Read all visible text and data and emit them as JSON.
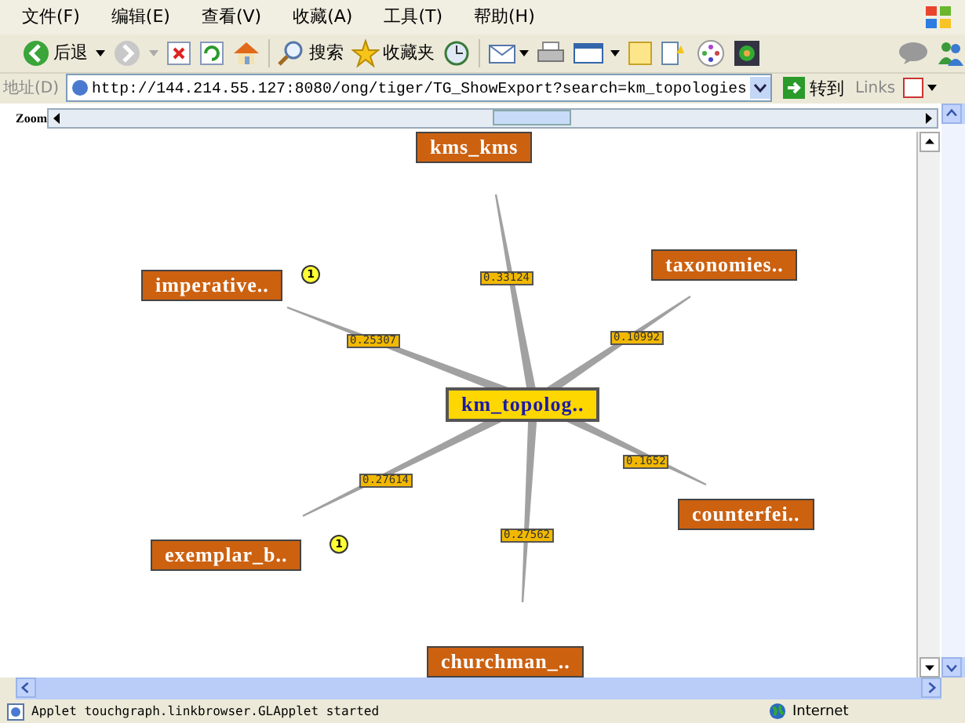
{
  "menu": [
    "文件(F)",
    "编辑(E)",
    "查看(V)",
    "收藏(A)",
    "工具(T)",
    "帮助(H)"
  ],
  "toolbar": {
    "back": "后退",
    "search": "搜索",
    "favorites": "收藏夹"
  },
  "address": {
    "label": "地址(D)",
    "url": "http://144.214.55.127:8080/ong/tiger/TG_ShowExport?search=km_topologies",
    "go": "转到",
    "links": "Links"
  },
  "applet": {
    "zoom": {
      "label": "Zoom",
      "level": 0.5
    },
    "center": {
      "label": "km_topolog.."
    },
    "nodes": [
      {
        "label": "kms_kms",
        "edge_label": "0.33124"
      },
      {
        "label": "imperative..",
        "edge_label": "0.25307",
        "badge": "1"
      },
      {
        "label": "taxonomies..",
        "edge_label": "0.10992"
      },
      {
        "label": "counterfei..",
        "edge_label": "0.1652"
      },
      {
        "label": "exemplar_b..",
        "edge_label": "0.27614",
        "badge": "1"
      },
      {
        "label": "churchman_..",
        "edge_label": "0.27562"
      }
    ]
  },
  "status_bar": {
    "text": "Applet touchgraph.linkbrowser.GLApplet started",
    "zone": "Internet"
  }
}
